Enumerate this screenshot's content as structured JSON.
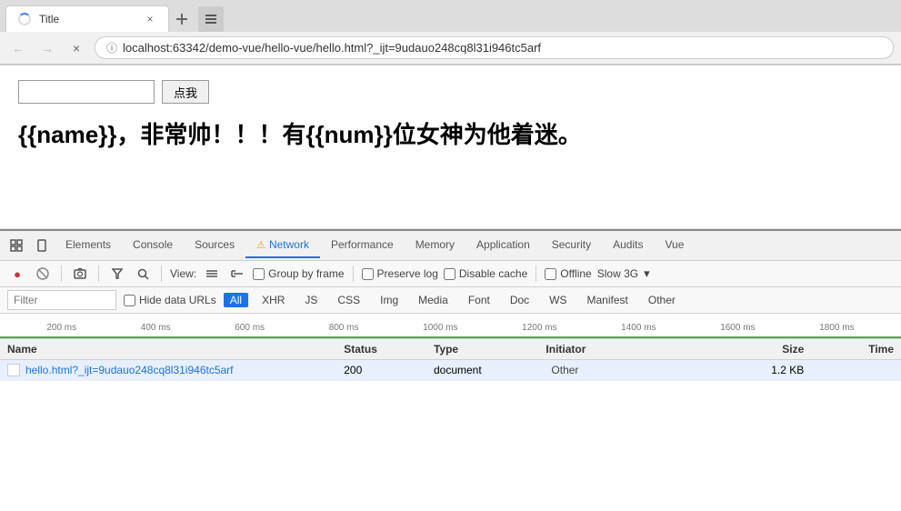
{
  "browser": {
    "tab": {
      "favicon": "spinner",
      "title": "Title",
      "close_label": "×"
    },
    "nav": {
      "back_label": "←",
      "forward_label": "→",
      "close_label": "×",
      "url": "localhost:63342/demo-vue/hello-vue/hello.html?_ijt=9udauo248cq8l31i946tc5arf",
      "url_icon": "ⓘ"
    }
  },
  "page": {
    "button_label": "点我",
    "input_value": "",
    "input_placeholder": "",
    "body_text": "{{name}}，非常帅！！！有{{num}}位女神为他着迷。"
  },
  "devtools": {
    "icon_btns": [
      "⊡",
      "□"
    ],
    "tabs": [
      {
        "id": "elements",
        "label": "Elements",
        "active": false,
        "warn": false
      },
      {
        "id": "console",
        "label": "Console",
        "active": false,
        "warn": false
      },
      {
        "id": "sources",
        "label": "Sources",
        "active": false,
        "warn": false
      },
      {
        "id": "network",
        "label": "Network",
        "active": true,
        "warn": true
      },
      {
        "id": "performance",
        "label": "Performance",
        "active": false,
        "warn": false
      },
      {
        "id": "memory",
        "label": "Memory",
        "active": false,
        "warn": false
      },
      {
        "id": "application",
        "label": "Application",
        "active": false,
        "warn": false
      },
      {
        "id": "security",
        "label": "Security",
        "active": false,
        "warn": false
      },
      {
        "id": "audits",
        "label": "Audits",
        "active": false,
        "warn": false
      },
      {
        "id": "vue",
        "label": "Vue",
        "active": false,
        "warn": false
      }
    ],
    "toolbar": {
      "record_label": "●",
      "stop_label": "🚫",
      "camera_label": "📷",
      "filter_label": "▽",
      "search_label": "🔍",
      "view_label": "View:",
      "list_icon": "≡",
      "tree_icon": "⊣",
      "group_frame_label": "Group by frame",
      "preserve_log_label": "Preserve log",
      "disable_cache_label": "Disable cache",
      "offline_label": "Offline",
      "throttle_label": "Slow 3G",
      "throttle_arrow": "▾"
    },
    "filter": {
      "input_placeholder": "Filter",
      "hide_data_urls_label": "Hide data URLs",
      "all_label": "All",
      "xhr_label": "XHR",
      "js_label": "JS",
      "css_label": "CSS",
      "img_label": "Img",
      "media_label": "Media",
      "font_label": "Font",
      "doc_label": "Doc",
      "ws_label": "WS",
      "manifest_label": "Manifest",
      "other_label": "Other"
    },
    "timeline": {
      "ticks": [
        "200 ms",
        "400 ms",
        "600 ms",
        "800 ms",
        "1000 ms",
        "1200 ms",
        "1400 ms",
        "1600 ms",
        "1800 ms"
      ]
    },
    "table": {
      "headers": {
        "name": "Name",
        "status": "Status",
        "type": "Type",
        "initiator": "Initiator",
        "size": "Size",
        "time": "Time"
      },
      "rows": [
        {
          "name": "hello.html?_ijt=9udauo248cq8l31i946tc5arf",
          "status": "200",
          "type": "document",
          "initiator": "Other",
          "size": "1.2 KB",
          "time": "",
          "selected": true
        }
      ]
    }
  }
}
